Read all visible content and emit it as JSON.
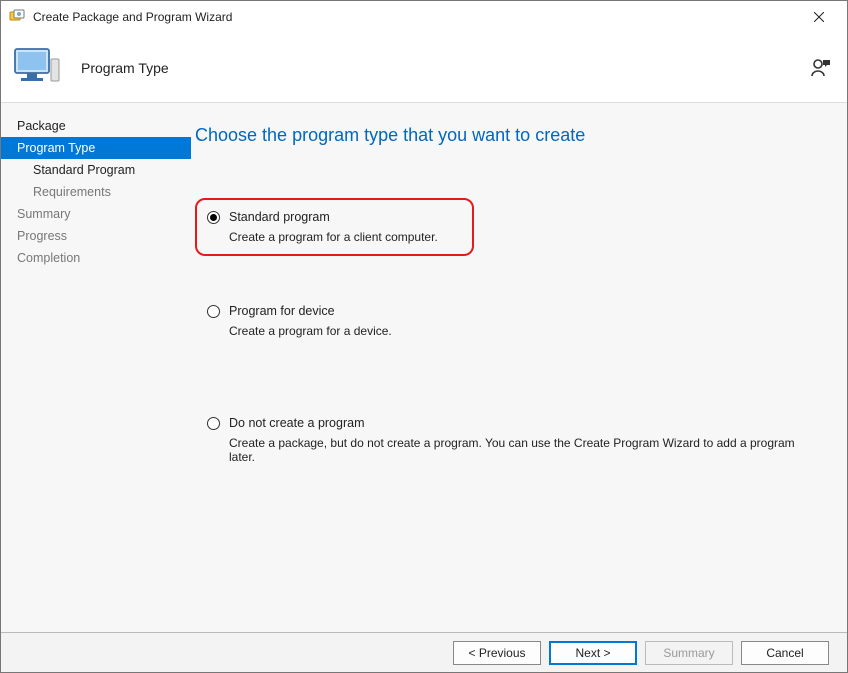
{
  "window": {
    "title": "Create Package and Program Wizard"
  },
  "header": {
    "page_title": "Program Type"
  },
  "sidebar": {
    "items": [
      {
        "label": "Package"
      },
      {
        "label": "Program Type"
      },
      {
        "label": "Standard Program"
      },
      {
        "label": "Requirements"
      },
      {
        "label": "Summary"
      },
      {
        "label": "Progress"
      },
      {
        "label": "Completion"
      }
    ]
  },
  "content": {
    "heading": "Choose the program type that you want to create",
    "options": [
      {
        "label": "Standard program",
        "description": "Create a program for a client computer.",
        "selected": true
      },
      {
        "label": "Program for device",
        "description": "Create a program for a device.",
        "selected": false
      },
      {
        "label": "Do not create a program",
        "description": "Create a package, but do not create a program. You can use the Create Program Wizard to add a program later.",
        "selected": false
      }
    ]
  },
  "footer": {
    "previous": "< Previous",
    "next": "Next >",
    "summary": "Summary",
    "cancel": "Cancel"
  }
}
